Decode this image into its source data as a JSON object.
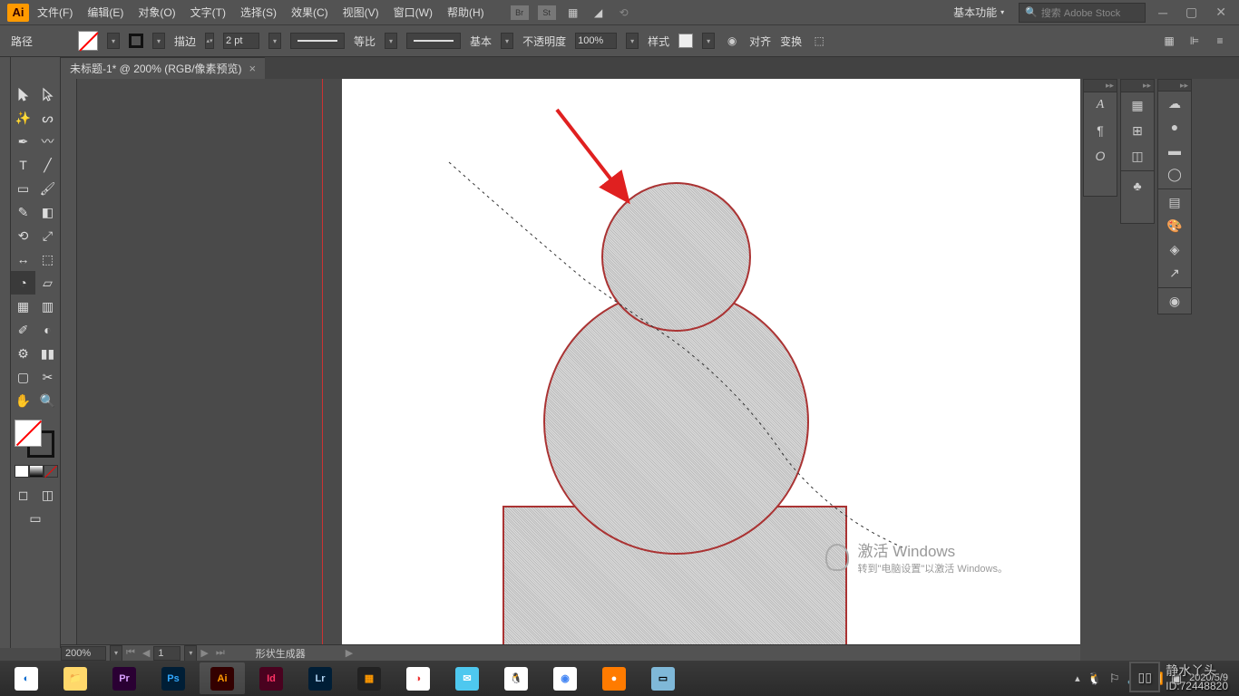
{
  "app": {
    "logo": "Ai"
  },
  "menu": {
    "items": [
      "文件(F)",
      "编辑(E)",
      "对象(O)",
      "文字(T)",
      "选择(S)",
      "效果(C)",
      "视图(V)",
      "窗口(W)",
      "帮助(H)"
    ],
    "icons": [
      "Br",
      "St"
    ],
    "workspace": "基本功能",
    "search_placeholder": "搜索 Adobe Stock"
  },
  "control": {
    "label": "路径",
    "stroke_label": "描边",
    "stroke_value": "2 pt",
    "profile_label": "等比",
    "brush_label": "基本",
    "opacity_label": "不透明度",
    "opacity_value": "100%",
    "style_label": "样式",
    "align_label": "对齐",
    "transform_label": "变换"
  },
  "document": {
    "tab_title": "未标题-1* @ 200% (RGB/像素预览)"
  },
  "status": {
    "zoom": "200%",
    "page": "1",
    "tool": "形状生成器"
  },
  "watermark": {
    "title": "激活 Windows",
    "subtitle": "转到\"电脑设置\"以激活 Windows。"
  },
  "author": {
    "name": "静水丫头",
    "id": "ID:72448820"
  },
  "tray": {
    "time": "",
    "date": "2020/5/9"
  },
  "taskbar_apps": [
    {
      "bg": "#fff",
      "fg": "#06c",
      "txt": "◐"
    },
    {
      "bg": "#ffd86b",
      "fg": "#333",
      "txt": "📁"
    },
    {
      "bg": "#2a0033",
      "fg": "#d9a0ff",
      "txt": "Pr"
    },
    {
      "bg": "#001e36",
      "fg": "#31a8ff",
      "txt": "Ps"
    },
    {
      "bg": "#330000",
      "fg": "#ff9a00",
      "txt": "Ai"
    },
    {
      "bg": "#49021f",
      "fg": "#ff3366",
      "txt": "Id"
    },
    {
      "bg": "#001e36",
      "fg": "#aed3f2",
      "txt": "Lr"
    },
    {
      "bg": "#222",
      "fg": "#ff9900",
      "txt": "▦"
    },
    {
      "bg": "#fff",
      "fg": "#e33",
      "txt": "◑"
    },
    {
      "bg": "#4ec8ef",
      "fg": "#fff",
      "txt": "✉"
    },
    {
      "bg": "#fff",
      "fg": "#000",
      "txt": "🐧"
    },
    {
      "bg": "#fff",
      "fg": "#4285f4",
      "txt": "◉"
    },
    {
      "bg": "#ff7b00",
      "fg": "#fff",
      "txt": "●"
    },
    {
      "bg": "#7fb8d8",
      "fg": "#fff",
      "txt": "▭"
    }
  ]
}
